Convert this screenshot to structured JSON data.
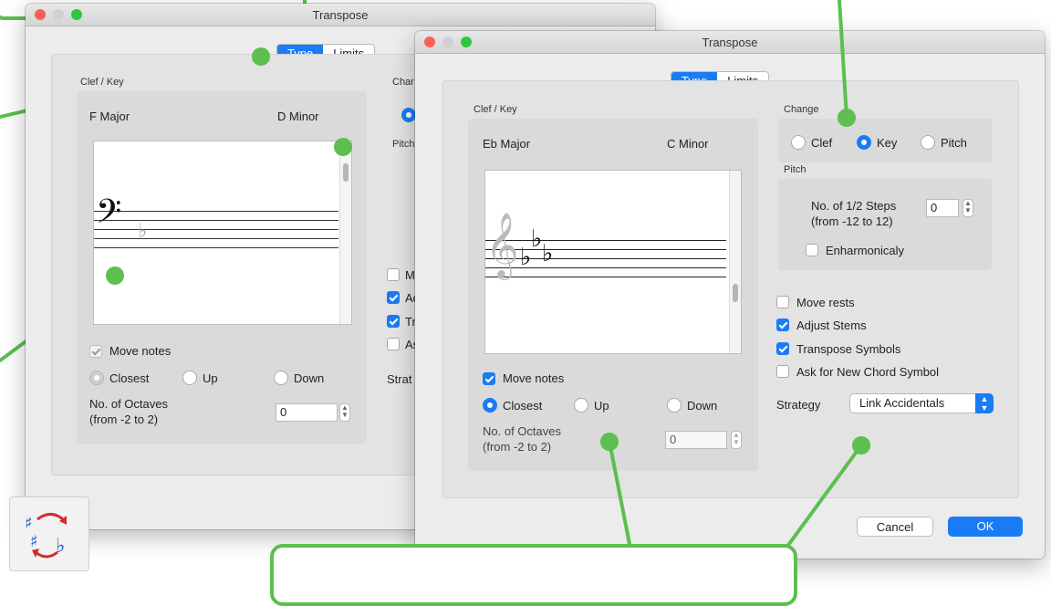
{
  "back_window": {
    "title": "Transpose",
    "tabs": [
      {
        "label": "Type"
      },
      {
        "label": "Limits"
      }
    ],
    "clef_key": {
      "group_label": "Clef / Key",
      "left_key": "F Major",
      "right_key": "D Minor"
    },
    "change_label_partial": "Char",
    "pitch_label_partial": "Pitch",
    "move_notes": {
      "label": "Move notes",
      "checked": true
    },
    "direction": {
      "options": [
        "Closest",
        "Up",
        "Down"
      ],
      "selected": "Closest"
    },
    "octaves": {
      "label_line1": "No. of Octaves",
      "label_line2": "(from -2 to 2)",
      "value": "0"
    },
    "options_partial": [
      {
        "label": "Mo",
        "checked": false
      },
      {
        "label": "Ac",
        "checked": true
      },
      {
        "label": "Tr",
        "checked": true
      },
      {
        "label": "As",
        "checked": false
      }
    ],
    "strategy_partial": "Strat"
  },
  "front_window": {
    "title": "Transpose",
    "tabs": [
      {
        "label": "Type"
      },
      {
        "label": "Limits"
      }
    ],
    "selected_tab": "Type",
    "clef_key": {
      "group_label": "Clef / Key",
      "left_key": "Eb Major",
      "right_key": "C Minor"
    },
    "change": {
      "label": "Change",
      "options": [
        "Clef",
        "Key",
        "Pitch"
      ],
      "selected": "Key"
    },
    "pitch": {
      "label": "Pitch",
      "steps_line1": "No. of 1/2 Steps",
      "steps_line2": "(from -12 to 12)",
      "steps_value": "0",
      "enharmonic_label": "Enharmonicaly",
      "enharmonic_checked": false
    },
    "options": [
      {
        "label": "Move rests",
        "checked": false
      },
      {
        "label": "Adjust Stems",
        "checked": true
      },
      {
        "label": "Transpose Symbols",
        "checked": true
      },
      {
        "label": "Ask for New Chord Symbol",
        "checked": false
      }
    ],
    "strategy": {
      "label": "Strategy",
      "value": "Link Accidentals"
    },
    "move_notes": {
      "label": "Move notes",
      "checked": true
    },
    "direction": {
      "options": [
        "Closest",
        "Up",
        "Down"
      ],
      "selected": "Closest"
    },
    "octaves": {
      "label_line1": "No. of Octaves",
      "label_line2": "(from -2 to 2)",
      "value": "0"
    },
    "buttons": {
      "cancel": "Cancel",
      "ok": "OK"
    }
  },
  "colors": {
    "accent": "#1a7cf4",
    "callout": "#5cbf4f"
  },
  "app_icon": {
    "name": "transpose-tool-icon"
  }
}
